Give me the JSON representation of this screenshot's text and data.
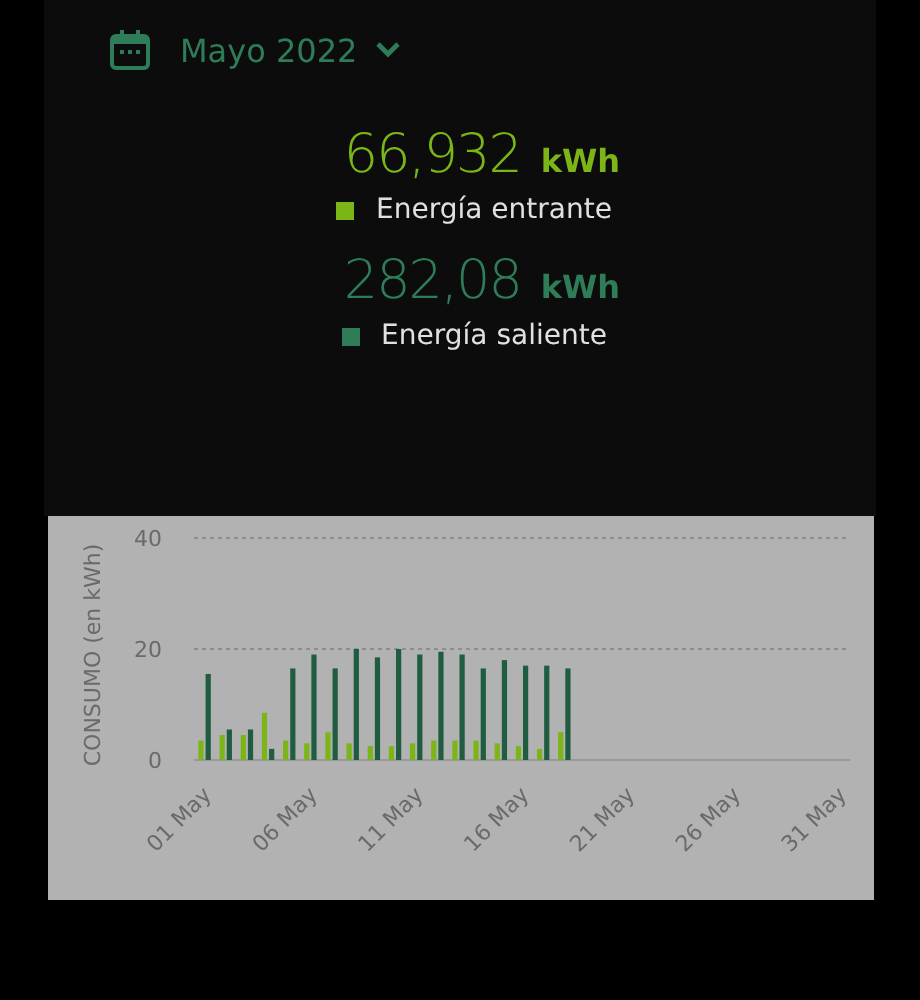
{
  "period": {
    "label": "Mayo 2022",
    "expanded": false
  },
  "totals": [
    {
      "value": "66,932",
      "unit": "kWh",
      "label": "Energía entrante",
      "color": "#7cb518"
    },
    {
      "value": "282,08",
      "unit": "kWh",
      "label": "Energía saliente",
      "color": "#2e7d58"
    }
  ],
  "chart": {
    "chart_data": {
      "type": "bar",
      "ylabel": "CONSUMO (en kWh)",
      "categories": [
        "01 May",
        null,
        null,
        null,
        null,
        "06 May",
        null,
        null,
        null,
        null,
        "11 May",
        null,
        null,
        null,
        null,
        "16 May",
        null,
        null,
        null,
        null,
        "21 May",
        null,
        null,
        null,
        null,
        "26 May",
        null,
        null,
        null,
        null,
        "31 May"
      ],
      "series": [
        {
          "color": "#7cb518",
          "values": [
            3.5,
            4.5,
            4.5,
            8.5,
            3.5,
            3,
            5,
            3,
            2.5,
            2.5,
            3,
            3.5,
            3.5,
            3.5,
            3,
            2.5,
            2,
            5,
            null,
            null,
            null,
            null,
            null,
            null,
            null,
            null,
            null,
            null,
            null,
            null,
            null
          ]
        },
        {
          "color": "#1f5c40",
          "values": [
            15.5,
            5.5,
            5.5,
            2,
            16.5,
            19,
            16.5,
            20,
            18.5,
            20,
            19,
            19.5,
            19,
            16.5,
            18,
            17,
            17,
            16.5,
            null,
            null,
            null,
            null,
            null,
            null,
            null,
            null,
            null,
            null,
            null,
            null,
            null
          ]
        }
      ],
      "ylim": [
        0,
        40
      ],
      "yticks": [
        0,
        20,
        40
      ]
    }
  }
}
